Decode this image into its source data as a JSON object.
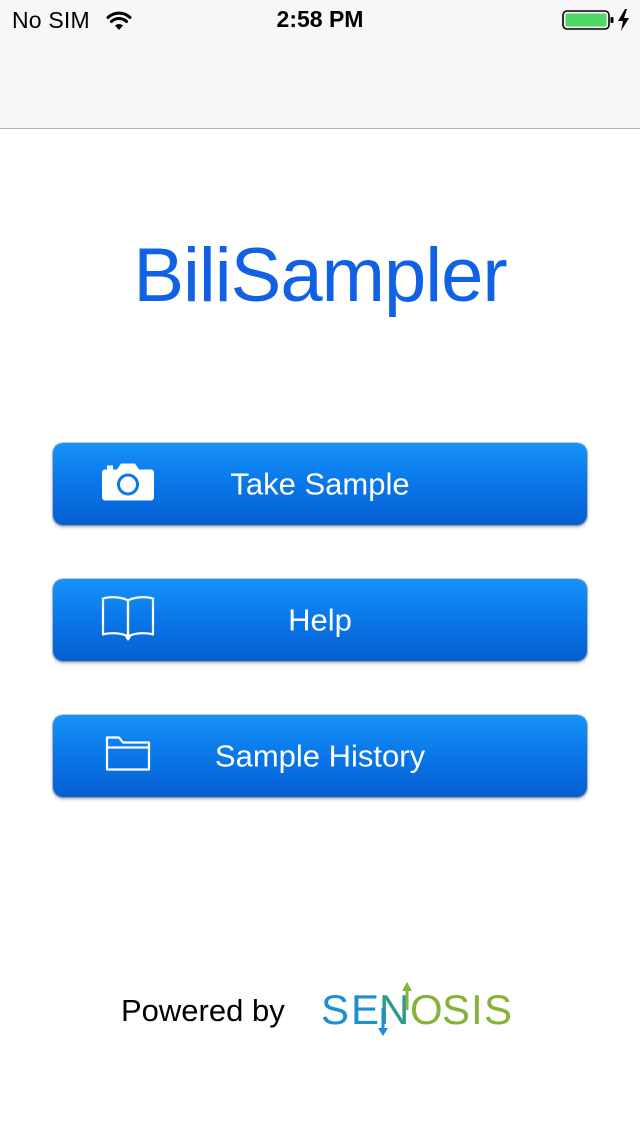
{
  "status_bar": {
    "carrier": "No SIM",
    "time": "2:58 PM",
    "battery_level": 1.0
  },
  "app": {
    "title": "BiliSampler"
  },
  "buttons": [
    {
      "label": "Take Sample",
      "icon": "camera-icon"
    },
    {
      "label": "Help",
      "icon": "book-icon"
    },
    {
      "label": "Sample History",
      "icon": "folder-icon"
    }
  ],
  "footer": {
    "powered_by": "Powered by",
    "logo_text": "SENOSIS"
  },
  "colors": {
    "title": "#1161e6",
    "button_top": "#1692f6",
    "button_bottom": "#045fd0",
    "logo_blue": "#1e8fd0",
    "logo_green": "#86b43a",
    "battery_green": "#4cd964"
  }
}
